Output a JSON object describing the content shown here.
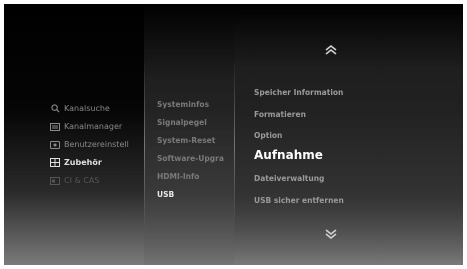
{
  "left_menu": {
    "items": [
      {
        "label": "Kanalsuche",
        "icon": "search-icon",
        "state": "normal"
      },
      {
        "label": "Kanalmanager",
        "icon": "list-icon",
        "state": "normal"
      },
      {
        "label": "Benutzereinstell",
        "icon": "user-settings-icon",
        "state": "normal"
      },
      {
        "label": "Zubehör",
        "icon": "accessories-icon",
        "state": "active"
      },
      {
        "label": "CI & CAS",
        "icon": "card-icon",
        "state": "dim"
      }
    ]
  },
  "middle_menu": {
    "items": [
      {
        "label": "Systeminfos",
        "state": "normal"
      },
      {
        "label": "Signalpegel",
        "state": "normal"
      },
      {
        "label": "System-Reset",
        "state": "normal"
      },
      {
        "label": "Software-Upgra",
        "state": "normal"
      },
      {
        "label": "HDMI-Info",
        "state": "normal"
      },
      {
        "label": "USB",
        "state": "active"
      }
    ]
  },
  "right_menu": {
    "items": [
      {
        "label": "Speicher Information",
        "state": "normal"
      },
      {
        "label": "Formatieren",
        "state": "normal"
      },
      {
        "label": "Option",
        "state": "normal"
      },
      {
        "label": "Aufnahme",
        "state": "active"
      },
      {
        "label": "Dateiverwaltung",
        "state": "normal"
      },
      {
        "label": "USB sicher entfernen",
        "state": "normal"
      }
    ]
  },
  "scroll": {
    "up_icon": "chevron-up-icon",
    "down_icon": "chevron-down-icon"
  },
  "colors": {
    "active": "#ffffff",
    "inactive": "#8a8a8a",
    "background": "#000000"
  }
}
